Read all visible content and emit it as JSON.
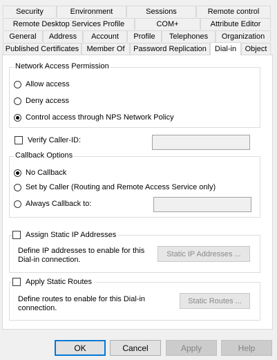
{
  "tabs": {
    "row1": [
      "Security",
      "Environment",
      "Sessions",
      "Remote control"
    ],
    "row2": [
      "Remote Desktop Services Profile",
      "COM+",
      "Attribute Editor"
    ],
    "row3": [
      "General",
      "Address",
      "Account",
      "Profile",
      "Telephones",
      "Organization"
    ],
    "row4": [
      "Published Certificates",
      "Member Of",
      "Password Replication",
      "Dial-in",
      "Object"
    ],
    "active": "Dial-in"
  },
  "network_access": {
    "legend": "Network Access Permission",
    "options": [
      "Allow access",
      "Deny access",
      "Control access through NPS Network Policy"
    ],
    "selected": "Control access through NPS Network Policy"
  },
  "verify_caller": {
    "label": "Verify Caller-ID:",
    "checked": false,
    "value": ""
  },
  "callback": {
    "legend": "Callback Options",
    "options": [
      "No Callback",
      "Set by Caller (Routing and Remote Access Service only)",
      "Always Callback to:"
    ],
    "selected": "No Callback",
    "callback_number": ""
  },
  "static_ip": {
    "label": "Assign Static IP Addresses",
    "checked": false,
    "description": "Define IP addresses to enable for this Dial-in connection.",
    "button": "Static IP Addresses ..."
  },
  "static_routes": {
    "label": "Apply Static Routes",
    "checked": false,
    "description": "Define routes to enable for this Dial-in connection.",
    "button": "Static Routes ..."
  },
  "footer": {
    "ok": "OK",
    "cancel": "Cancel",
    "apply": "Apply",
    "help": "Help"
  }
}
